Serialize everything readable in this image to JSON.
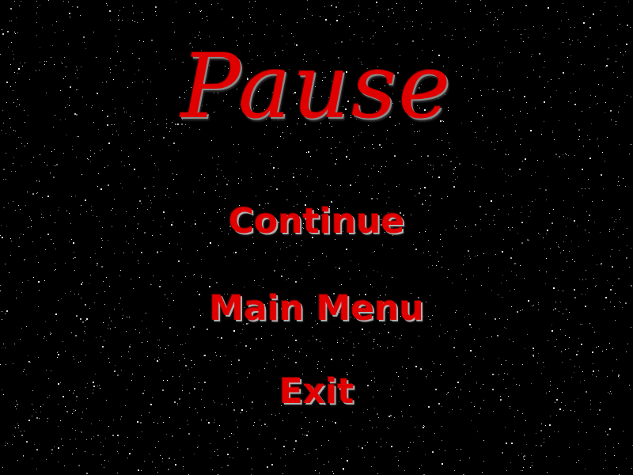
{
  "pause_menu": {
    "title": "Pause",
    "items": [
      {
        "label": "Continue"
      },
      {
        "label": "Main Menu"
      },
      {
        "label": "Exit"
      }
    ]
  },
  "colors": {
    "background": "#000000",
    "text": "#e00000",
    "stars": "#ffffff"
  }
}
